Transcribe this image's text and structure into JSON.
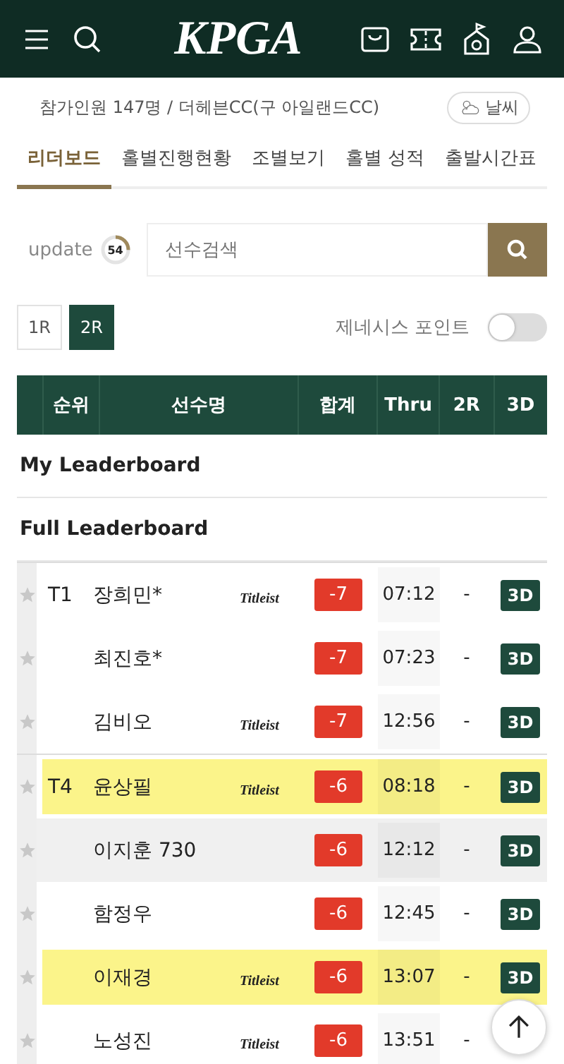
{
  "header": {
    "logo": "KPGA"
  },
  "info": {
    "text": "참가인원 147명 / 더헤븐CC(구 아일랜드CC)",
    "weather_button": "날씨"
  },
  "tabs": [
    {
      "label": "리더보드",
      "selected": true
    },
    {
      "label": "홀별진행현황",
      "selected": false
    },
    {
      "label": "조별보기",
      "selected": false
    },
    {
      "label": "홀별 성적",
      "selected": false
    },
    {
      "label": "출발시간표",
      "selected": false
    }
  ],
  "update": {
    "label": "update",
    "count": "54"
  },
  "search": {
    "placeholder": "선수검색"
  },
  "rounds": [
    {
      "label": "1R",
      "selected": false
    },
    {
      "label": "2R",
      "selected": true
    }
  ],
  "genesis_points": {
    "label": "제네시스 포인트",
    "on": false
  },
  "table": {
    "columns": [
      "순위",
      "선수명",
      "합계",
      "Thru",
      "2R",
      "3D"
    ],
    "sections": [
      "My Leaderboard",
      "Full Leaderboard"
    ],
    "rows": [
      {
        "rank": "T1",
        "name": "장희민*",
        "sponsor": "Titleist",
        "total": "-7",
        "thru": "07:12",
        "r2": "-",
        "badge": "3D",
        "highlighted": false,
        "shaded": false,
        "group_start": true
      },
      {
        "name": "최진호*",
        "total": "-7",
        "thru": "07:23",
        "r2": "-",
        "badge": "3D",
        "highlighted": false,
        "shaded": false,
        "group_start": false
      },
      {
        "name": "김비오",
        "sponsor": "Titleist",
        "total": "-7",
        "thru": "12:56",
        "r2": "-",
        "badge": "3D",
        "highlighted": false,
        "shaded": false,
        "group_start": false
      },
      {
        "rank": "T4",
        "name": "윤상필",
        "sponsor": "Titleist",
        "total": "-6",
        "thru": "08:18",
        "r2": "-",
        "badge": "3D",
        "highlighted": true,
        "shaded": false,
        "group_start": true
      },
      {
        "name": "이지훈 730",
        "total": "-6",
        "thru": "12:12",
        "r2": "-",
        "badge": "3D",
        "highlighted": false,
        "shaded": true,
        "group_start": false
      },
      {
        "name": "함정우",
        "total": "-6",
        "thru": "12:45",
        "r2": "-",
        "badge": "3D",
        "highlighted": false,
        "shaded": false,
        "group_start": false
      },
      {
        "name": "이재경",
        "sponsor": "Titleist",
        "total": "-6",
        "thru": "13:07",
        "r2": "-",
        "badge": "3D",
        "highlighted": true,
        "shaded": false,
        "group_start": false
      },
      {
        "name": "노성진",
        "sponsor": "Titleist",
        "total": "-6",
        "thru": "13:51",
        "r2": "-",
        "highlighted": false,
        "shaded": false,
        "group_start": false
      }
    ]
  }
}
